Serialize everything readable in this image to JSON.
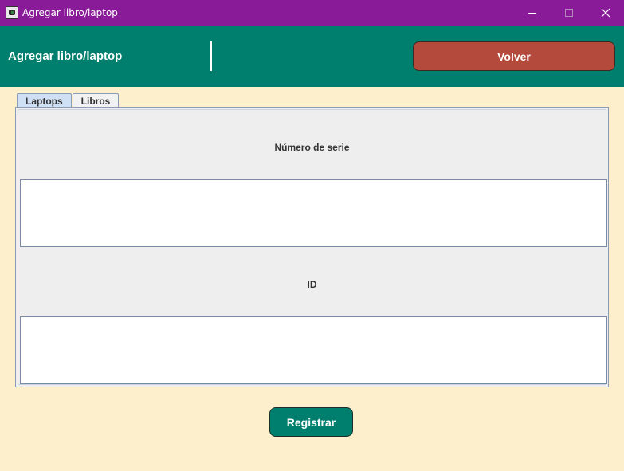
{
  "window": {
    "title": "Agregar libro/laptop",
    "icon": "app-icon"
  },
  "header": {
    "title": "Agregar libro/laptop",
    "back_label": "Volver"
  },
  "tabs": [
    {
      "label": "Laptops",
      "selected": true
    },
    {
      "label": "Libros",
      "selected": false
    }
  ],
  "form": {
    "serial_label": "Número de serie",
    "serial_value": "",
    "id_label": "ID",
    "id_value": ""
  },
  "actions": {
    "register_label": "Registrar"
  },
  "colors": {
    "titlebar": "#891a98",
    "header": "#007f6e",
    "background": "#fdefcb",
    "back_button": "#b44a3b",
    "register_button": "#007f6e"
  }
}
